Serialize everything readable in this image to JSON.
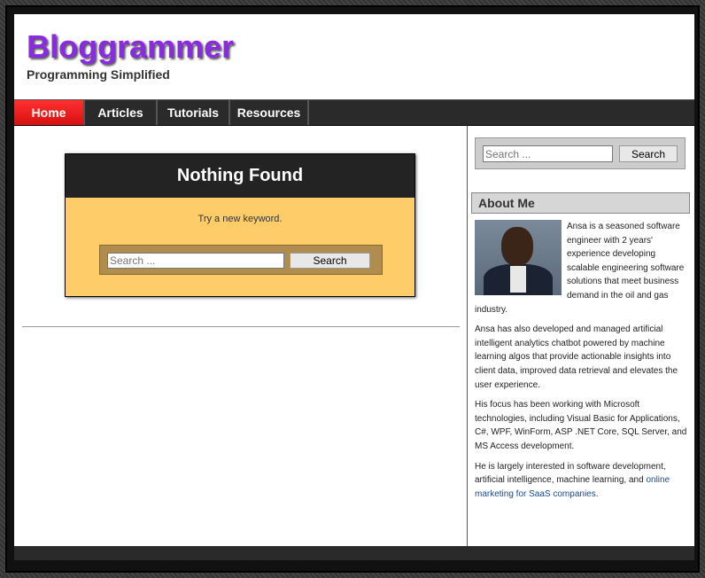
{
  "site": {
    "title": "Bloggrammer",
    "tagline": "Programming Simplified"
  },
  "nav": {
    "items": [
      "Home",
      "Articles",
      "Tutorials",
      "Resources"
    ],
    "active": "Home"
  },
  "main": {
    "nothing_found_title": "Nothing Found",
    "nothing_found_text": "Try a new keyword.",
    "search_placeholder": "Search ...",
    "search_button": "Search"
  },
  "sidebar": {
    "search_placeholder": "Search ...",
    "search_button": "Search",
    "about_title": "About Me",
    "about_p1": " Ansa is a seasoned software engineer with 2 years' experience developing scalable engineering software solutions that meet business demand in the oil and gas industry.",
    "about_p2": "Ansa has also developed and managed artificial intelligent analytics chatbot powered by machine learning algos that provide actionable insights into client data, improved data retrieval and elevates the user experience.",
    "about_p3": "His focus has been working with Microsoft technologies, including Visual Basic for Applications, C#, WPF, WinForm, ASP .NET Core, SQL Server, and MS Access development.",
    "about_p4": "He is largely interested in software development, artificial intelligence, machine learning, and",
    "about_link": "online marketing for SaaS companies",
    "about_p4_end": "."
  },
  "colors": {
    "title": "#8a2be2",
    "nav_active": "#e01818",
    "nothing_found_bg": "#ffcc6a",
    "link": "#1a4a8a"
  }
}
